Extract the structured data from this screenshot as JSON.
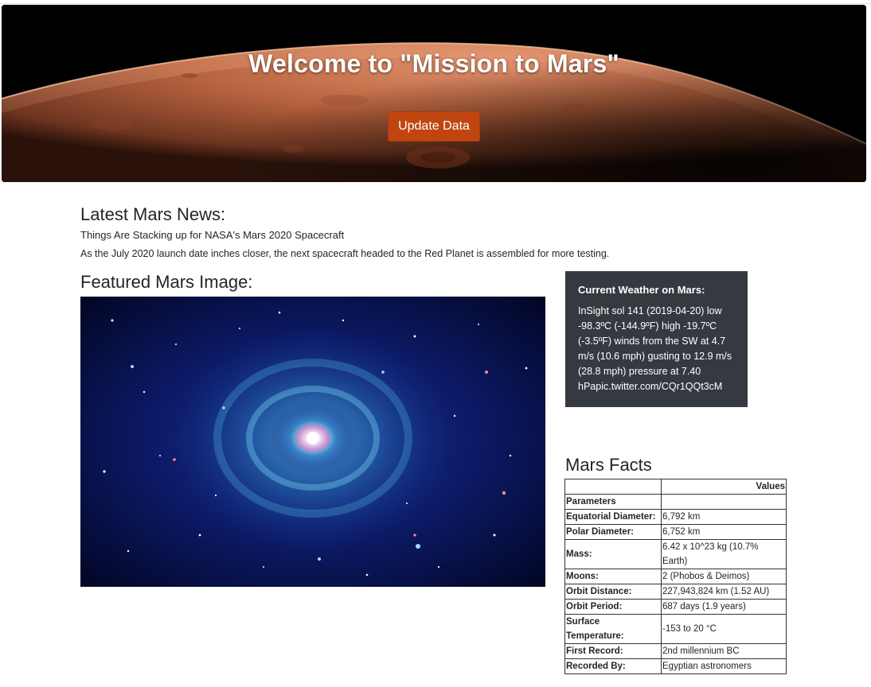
{
  "hero": {
    "title": "Welcome to \"Mission to Mars\"",
    "button_label": "Update Data"
  },
  "news": {
    "heading": "Latest Mars News:",
    "title": "Things Are Stacking up for NASA's Mars 2020 Spacecraft",
    "paragraph": "As the July 2020 launch date inches closer, the next spacecraft headed to the Red Planet is assembled for more testing."
  },
  "featured": {
    "heading": "Featured Mars Image:"
  },
  "weather": {
    "title": "Current Weather on Mars:",
    "text": "InSight sol 141 (2019-04-20) low -98.3ºC (-144.9ºF) high -19.7ºC (-3.5ºF) winds from the SW at 4.7 m/s (10.6 mph) gusting to 12.9 m/s (28.8 mph) pressure at 7.40 hPapic.twitter.com/CQr1QQt3cM"
  },
  "facts": {
    "heading": "Mars Facts",
    "values_header": "Values",
    "index_header": "Parameters",
    "rows": [
      {
        "param": "Equatorial Diameter:",
        "value": "6,792 km"
      },
      {
        "param": "Polar Diameter:",
        "value": "6,752 km"
      },
      {
        "param": "Mass:",
        "value": "6.42 x 10^23 kg (10.7% Earth)"
      },
      {
        "param": "Moons:",
        "value": "2 (Phobos & Deimos)"
      },
      {
        "param": "Orbit Distance:",
        "value": "227,943,824 km (1.52 AU)"
      },
      {
        "param": "Orbit Period:",
        "value": "687 days (1.9 years)"
      },
      {
        "param": "Surface Temperature:",
        "value": "-153 to 20 °C"
      },
      {
        "param": "First Record:",
        "value": "2nd millennium BC"
      },
      {
        "param": "Recorded By:",
        "value": "Egyptian astronomers"
      }
    ]
  },
  "colors": {
    "button": "#c0450f",
    "weather_card": "#343a40"
  }
}
